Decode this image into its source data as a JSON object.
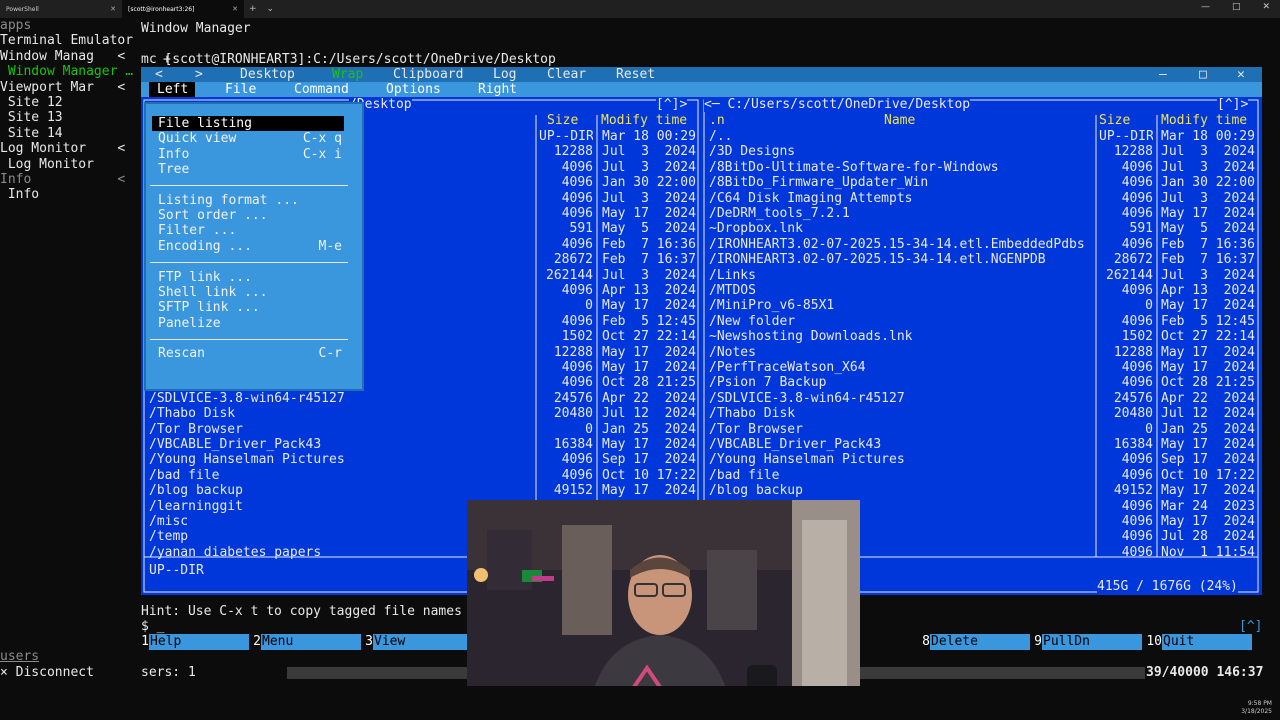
{
  "tabs": [
    {
      "label": "PowerShell"
    },
    {
      "label": "[scott@ironheart3:26]"
    }
  ],
  "tab_new": "+",
  "tab_dropdown": "⌄",
  "window_controls": {
    "minimize": "—",
    "maximize": "□",
    "close": "✕"
  },
  "tmux_left": {
    "header": "apps",
    "rows": [
      {
        "text": "Terminal Emulator",
        "color": "white"
      },
      {
        "text": "Window Manag   <",
        "color": "white"
      },
      {
        "text": " Window Manager …",
        "color": "green"
      },
      {
        "text": "Viewport Mar   <",
        "color": "white"
      },
      {
        "text": " Site 12",
        "color": "white"
      },
      {
        "text": " Site 13",
        "color": "white"
      },
      {
        "text": " Site 14",
        "color": "white"
      },
      {
        "text": "Log Monitor    <",
        "color": "white"
      },
      {
        "text": " Log Monitor",
        "color": "white"
      },
      {
        "text": "Info           <",
        "color": "gray"
      },
      {
        "text": " Info",
        "color": "white"
      }
    ],
    "users_label": "users",
    "disconnect": "× Disconnect"
  },
  "wm": {
    "title": "Window Manager",
    "toolbar": [
      "+",
      ":::",
      "│",
      "—",
      "┌┘",
      "⟷",
      ">|<",
      "\"…\"",
      "×"
    ],
    "path": "mc [scott@IRONHEART3]:C:/Users/scott/OneDrive/Desktop"
  },
  "mc_toolbar": [
    "<",
    ">",
    "Desktop",
    "Wrap",
    "Clipboard",
    "Log",
    "Clear",
    "Reset"
  ],
  "mc_menubar": [
    "Left",
    "File",
    "Command",
    "Options",
    "Right"
  ],
  "left_panel": {
    "title": "/Desktop",
    "path_suffix": "[^]>",
    "headers": {
      "name": "e",
      "size": "Size",
      "time": "Modify time"
    },
    "rows": [
      {
        "name": "",
        "size": "UP--DIR",
        "time": "Mar 18 00:29"
      },
      {
        "name": "",
        "size": "12288",
        "time": "Jul  3  2024"
      },
      {
        "name": "for-Windows",
        "size": "4096",
        "time": "Jul  3  2024"
      },
      {
        "name": "in",
        "size": "4096",
        "time": "Jan 30 22:00"
      },
      {
        "name": "",
        "size": "4096",
        "time": "Jul  3  2024"
      },
      {
        "name": "",
        "size": "4096",
        "time": "May 17  2024"
      },
      {
        "name": "",
        "size": "591",
        "time": "May  5  2024"
      },
      {
        "name": "34-14.etl.EmbeddedPdbs",
        "size": "4096",
        "time": "Feb  7 16:36"
      },
      {
        "name": "34-14.etl.NGENPDB",
        "size": "28672",
        "time": "Feb  7 16:37"
      },
      {
        "name": "",
        "size": "262144",
        "time": "Jul  3  2024"
      },
      {
        "name": "",
        "size": "4096",
        "time": "Apr 13  2024"
      },
      {
        "name": "",
        "size": "0",
        "time": "May 17  2024"
      },
      {
        "name": "",
        "size": "4096",
        "time": "Feb  5 12:45"
      },
      {
        "name": "",
        "size": "1502",
        "time": "Oct 27 22:14"
      },
      {
        "name": "",
        "size": "12288",
        "time": "May 17  2024"
      },
      {
        "name": "",
        "size": "4096",
        "time": "May 17  2024"
      },
      {
        "name": "/Psion 7 Backup",
        "size": "4096",
        "time": "Oct 28 21:25"
      },
      {
        "name": "/SDLVICE-3.8-win64-r45127",
        "size": "24576",
        "time": "Apr 22  2024"
      },
      {
        "name": "/Thabo Disk",
        "size": "20480",
        "time": "Jul 12  2024"
      },
      {
        "name": "/Tor Browser",
        "size": "0",
        "time": "Jan 25  2024"
      },
      {
        "name": "/VBCABLE_Driver_Pack43",
        "size": "16384",
        "time": "May 17  2024"
      },
      {
        "name": "/Young Hanselman Pictures",
        "size": "4096",
        "time": "Sep 17  2024"
      },
      {
        "name": "/bad file",
        "size": "4096",
        "time": "Oct 10 17:22"
      },
      {
        "name": "/blog backup",
        "size": "49152",
        "time": "May 17  2024"
      },
      {
        "name": "/learninggit",
        "size": "",
        "time": ""
      },
      {
        "name": "/misc",
        "size": "",
        "time": ""
      },
      {
        "name": "/temp",
        "size": "",
        "time": ""
      },
      {
        "name": "/yanan diabetes papers",
        "size": "",
        "time": ""
      }
    ],
    "status": "UP--DIR"
  },
  "right_panel": {
    "title": "<─ C:/Users/scott/OneDrive/Desktop",
    "path_suffix": "[^]>",
    "headers": {
      "n": ".n",
      "name": "Name",
      "size": "Size",
      "time": "Modify time"
    },
    "rows": [
      {
        "name": "/..",
        "size": "UP--DIR",
        "time": "Mar 18 00:29"
      },
      {
        "name": "/3D Designs",
        "size": "12288",
        "time": "Jul  3  2024"
      },
      {
        "name": "/8BitDo-Ultimate-Software-for-Windows",
        "size": "4096",
        "time": "Jul  3  2024"
      },
      {
        "name": "/8BitDo_Firmware_Updater_Win",
        "size": "4096",
        "time": "Jan 30 22:00"
      },
      {
        "name": "/C64 Disk Imaging Attempts",
        "size": "4096",
        "time": "Jul  3  2024"
      },
      {
        "name": "/DeDRM_tools_7.2.1",
        "size": "4096",
        "time": "May 17  2024"
      },
      {
        "name": "~Dropbox.lnk",
        "size": "591",
        "time": "May  5  2024"
      },
      {
        "name": "/IRONHEART3.02-07-2025.15-34-14.etl.EmbeddedPdbs",
        "size": "4096",
        "time": "Feb  7 16:36"
      },
      {
        "name": "/IRONHEART3.02-07-2025.15-34-14.etl.NGENPDB",
        "size": "28672",
        "time": "Feb  7 16:37"
      },
      {
        "name": "/Links",
        "size": "262144",
        "time": "Jul  3  2024"
      },
      {
        "name": "/MTDOS",
        "size": "4096",
        "time": "Apr 13  2024"
      },
      {
        "name": "/MiniPro_v6-85X1",
        "size": "0",
        "time": "May 17  2024"
      },
      {
        "name": "/New folder",
        "size": "4096",
        "time": "Feb  5 12:45"
      },
      {
        "name": "~Newshosting Downloads.lnk",
        "size": "1502",
        "time": "Oct 27 22:14"
      },
      {
        "name": "/Notes",
        "size": "12288",
        "time": "May 17  2024"
      },
      {
        "name": "/PerfTraceWatson_X64",
        "size": "4096",
        "time": "May 17  2024"
      },
      {
        "name": "/Psion 7 Backup",
        "size": "4096",
        "time": "Oct 28 21:25"
      },
      {
        "name": "/SDLVICE-3.8-win64-r45127",
        "size": "24576",
        "time": "Apr 22  2024"
      },
      {
        "name": "/Thabo Disk",
        "size": "20480",
        "time": "Jul 12  2024"
      },
      {
        "name": "/Tor Browser",
        "size": "0",
        "time": "Jan 25  2024"
      },
      {
        "name": "/VBCABLE_Driver_Pack43",
        "size": "16384",
        "time": "May 17  2024"
      },
      {
        "name": "/Young Hanselman Pictures",
        "size": "4096",
        "time": "Sep 17  2024"
      },
      {
        "name": "/bad file",
        "size": "4096",
        "time": "Oct 10 17:22"
      },
      {
        "name": "/blog backup",
        "size": "49152",
        "time": "May 17  2024"
      },
      {
        "name": "",
        "size": "4096",
        "time": "Mar 24  2023"
      },
      {
        "name": "",
        "size": "4096",
        "time": "May 17  2024"
      },
      {
        "name": "",
        "size": "4096",
        "time": "Jul 28  2024"
      },
      {
        "name": "rs",
        "size": "4096",
        "time": "Nov  1 11:54"
      }
    ],
    "disk": "415G / 1676G (24%)"
  },
  "dropdown": {
    "items": [
      {
        "label": "File listing",
        "key": "",
        "selected": true
      },
      {
        "label": "Quick view",
        "key": "C-x q"
      },
      {
        "label": "Info",
        "key": "C-x i"
      },
      {
        "label": "Tree",
        "key": ""
      },
      {
        "label": "Listing format ...",
        "key": ""
      },
      {
        "label": "Sort order ...",
        "key": ""
      },
      {
        "label": "Filter ...",
        "key": ""
      },
      {
        "label": "Encoding ...",
        "key": "M-e"
      },
      {
        "label": "FTP link ...",
        "key": ""
      },
      {
        "label": "Shell link ...",
        "key": ""
      },
      {
        "label": "SFTP link ...",
        "key": ""
      },
      {
        "label": "Panelize",
        "key": ""
      },
      {
        "label": "Rescan",
        "key": "C-r"
      }
    ]
  },
  "hint": "Hint: Use C-x t to copy tagged file names t",
  "prompt": "$ _",
  "scroll_indicator": "[^]",
  "fkeys": [
    {
      "n": "1",
      "label": "Help"
    },
    {
      "n": "2",
      "label": "Menu"
    },
    {
      "n": "3",
      "label": "View"
    },
    {
      "n": "8",
      "label": "Delete"
    },
    {
      "n": "9",
      "label": "PullDn"
    },
    {
      "n": "10",
      "label": "Quit"
    }
  ],
  "statusbar": {
    "users": "sers: 1",
    "counter": "39/40000 146:37"
  },
  "taskbar": {
    "time": "9:58 PM",
    "date": "3/18/2025"
  },
  "colors": {
    "mc_blue": "#0037da",
    "mc_cyan": "#3a96dd",
    "menu_bar": "#1f6fb5",
    "accent_green": "#16c60c",
    "text_white": "#f2f2f2"
  }
}
